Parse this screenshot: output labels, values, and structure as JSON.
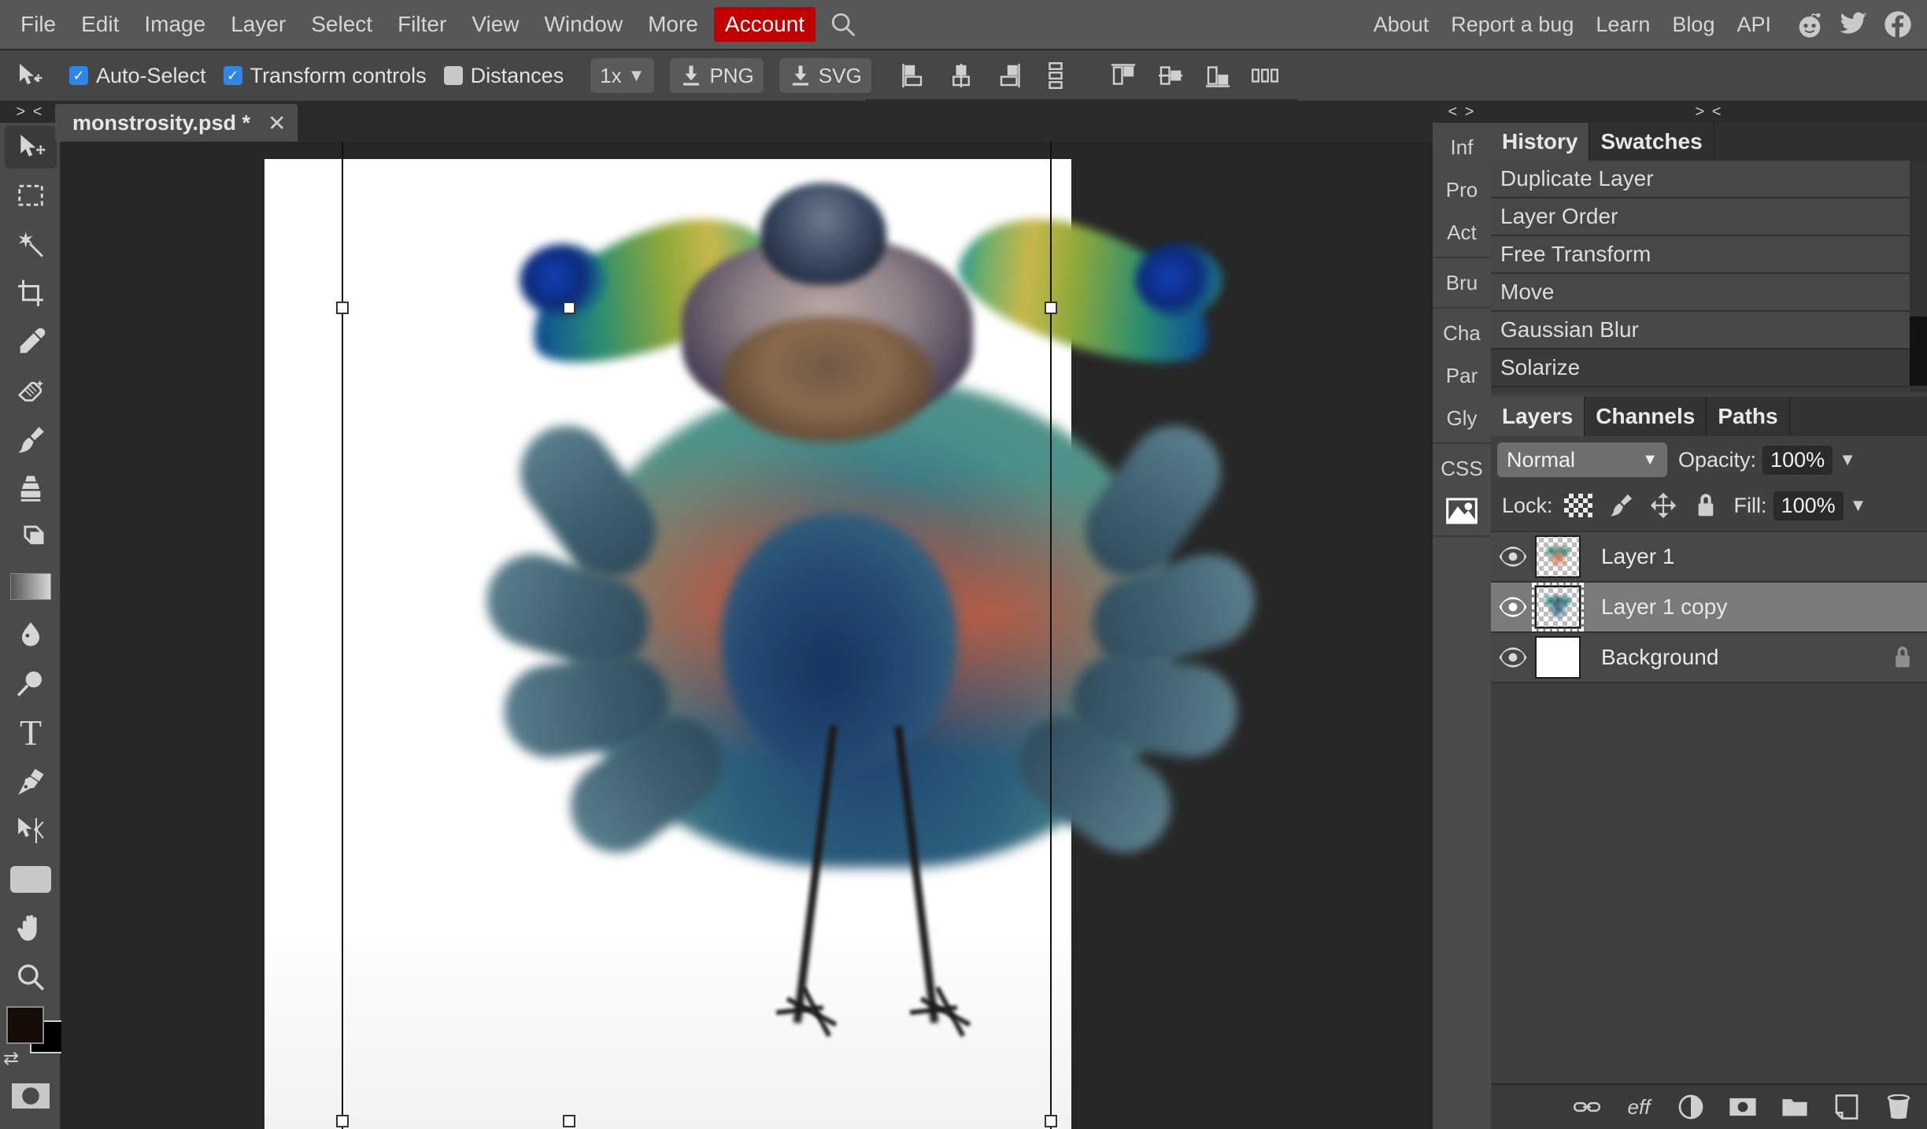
{
  "menubar": {
    "items": [
      {
        "label": "File",
        "name": "menu-file"
      },
      {
        "label": "Edit",
        "name": "menu-edit"
      },
      {
        "label": "Image",
        "name": "menu-image"
      },
      {
        "label": "Layer",
        "name": "menu-layer"
      },
      {
        "label": "Select",
        "name": "menu-select"
      },
      {
        "label": "Filter",
        "name": "menu-filter"
      },
      {
        "label": "View",
        "name": "menu-view"
      },
      {
        "label": "Window",
        "name": "menu-window"
      },
      {
        "label": "More",
        "name": "menu-more"
      }
    ],
    "account_label": "Account",
    "account_color": "#c00000",
    "search_icon": "search-icon",
    "right_items": [
      {
        "label": "About"
      },
      {
        "label": "Report a bug"
      },
      {
        "label": "Learn"
      },
      {
        "label": "Blog"
      },
      {
        "label": "API"
      }
    ],
    "social": [
      "reddit-icon",
      "twitter-icon",
      "facebook-icon"
    ]
  },
  "optionsbar": {
    "tool_icon": "move-tool-icon",
    "auto_select": {
      "label": "Auto-Select",
      "checked": true
    },
    "transform_controls": {
      "label": "Transform controls",
      "checked": true
    },
    "distances": {
      "label": "Distances",
      "checked": false
    },
    "zoom_level": "1x",
    "export_png": "PNG",
    "export_svg": "SVG",
    "align_group_1": [
      "align-left-icon",
      "align-center-horizontal-icon",
      "align-right-icon",
      "distribute-vertical-icon"
    ],
    "align_group_2": [
      "align-top-icon",
      "align-middle-vertical-icon",
      "align-bottom-icon",
      "distribute-horizontal-icon"
    ],
    "checkbox_color": "#2e86e6"
  },
  "toolbar": {
    "collapse_glyph": "> <",
    "tools": [
      {
        "name": "move-tool",
        "icon": "move-tool-icon",
        "active": true
      },
      {
        "name": "marquee-tool",
        "icon": "rectangular-marquee-icon",
        "active": false
      },
      {
        "name": "magic-wand-tool",
        "icon": "magic-wand-icon",
        "active": false
      },
      {
        "name": "crop-tool",
        "icon": "crop-icon",
        "active": false
      },
      {
        "name": "eyedropper-tool",
        "icon": "eyedropper-icon",
        "active": false
      },
      {
        "name": "eraser-tool",
        "icon": "eraser-icon",
        "active": false
      },
      {
        "name": "brush-tool",
        "icon": "paint-brush-icon",
        "active": false
      },
      {
        "name": "clone-stamp-tool",
        "icon": "clone-stamp-icon",
        "active": false
      },
      {
        "name": "dodge-burn-tool",
        "icon": "dodge-icon",
        "active": false
      },
      {
        "name": "gradient-tool",
        "icon": "gradient-icon",
        "active": false
      },
      {
        "name": "blur-tool",
        "icon": "water-drop-icon",
        "active": false
      },
      {
        "name": "sponge-tool",
        "icon": "sponge-icon",
        "active": false
      },
      {
        "name": "type-tool",
        "icon": "text-t-icon",
        "active": false
      },
      {
        "name": "pen-tool",
        "icon": "pen-nib-icon",
        "active": false
      },
      {
        "name": "path-select-tool",
        "icon": "path-select-icon",
        "active": false
      },
      {
        "name": "shape-tool",
        "icon": "rectangle-shape-icon",
        "active": false
      },
      {
        "name": "hand-tool",
        "icon": "hand-icon",
        "active": false
      },
      {
        "name": "zoom-tool",
        "icon": "magnifier-icon",
        "active": false
      }
    ],
    "foreground_color": "#150c08",
    "background_color": "#000000",
    "swap_icon": "swap-colors-icon",
    "quick_mask_icon": "quick-mask-icon"
  },
  "document": {
    "tab_title": "monstrosity.psd *",
    "close_icon": "close-icon",
    "canvas_background": "#262626",
    "paper_color": "#ffffff"
  },
  "rail": {
    "collapse_glyph": "< >",
    "groups": [
      [
        "Inf",
        "Pro",
        "Act"
      ],
      [
        "Bru"
      ],
      [
        "Cha",
        "Par",
        "Gly"
      ],
      [
        "CSS"
      ],
      [
        "image-thumb-icon"
      ]
    ]
  },
  "dock": {
    "collapse_glyph": "> <",
    "top_tabs": [
      {
        "label": "History",
        "active": true
      },
      {
        "label": "Swatches",
        "active": false
      }
    ],
    "history": [
      {
        "label": "Duplicate Layer",
        "current": false
      },
      {
        "label": "Layer Order",
        "current": false
      },
      {
        "label": "Free Transform",
        "current": false
      },
      {
        "label": "Move",
        "current": false
      },
      {
        "label": "Gaussian Blur",
        "current": false
      },
      {
        "label": "Solarize",
        "current": true
      }
    ],
    "layer_tabs": [
      {
        "label": "Layers",
        "active": true
      },
      {
        "label": "Channels",
        "active": false
      },
      {
        "label": "Paths",
        "active": false
      }
    ],
    "blend_mode": "Normal",
    "opacity_label": "Opacity:",
    "opacity_value": "100%",
    "lock_label": "Lock:",
    "lock_icons": [
      "transparency-lock-icon",
      "brush-lock-icon",
      "move-lock-icon",
      "lock-all-icon"
    ],
    "fill_label": "Fill:",
    "fill_value": "100%",
    "layers": [
      {
        "name": "Layer 1",
        "visible": true,
        "selected": false,
        "locked": false,
        "thumb": "artwork"
      },
      {
        "name": "Layer 1 copy",
        "visible": true,
        "selected": true,
        "locked": false,
        "thumb": "artwork"
      },
      {
        "name": "Background",
        "visible": true,
        "selected": false,
        "locked": true,
        "thumb": "white"
      }
    ],
    "footer_buttons": [
      {
        "name": "link-layers-button",
        "icon": "chain-link-icon",
        "label": ""
      },
      {
        "name": "layer-effects-button",
        "icon": "effects-icon",
        "label": "eff"
      },
      {
        "name": "adjustment-layer-button",
        "icon": "half-circle-icon",
        "label": ""
      },
      {
        "name": "layer-mask-button",
        "icon": "mask-icon",
        "label": ""
      },
      {
        "name": "new-group-button",
        "icon": "folder-icon",
        "label": ""
      },
      {
        "name": "new-layer-button",
        "icon": "new-page-icon",
        "label": ""
      },
      {
        "name": "delete-layer-button",
        "icon": "trash-icon",
        "label": ""
      }
    ]
  }
}
